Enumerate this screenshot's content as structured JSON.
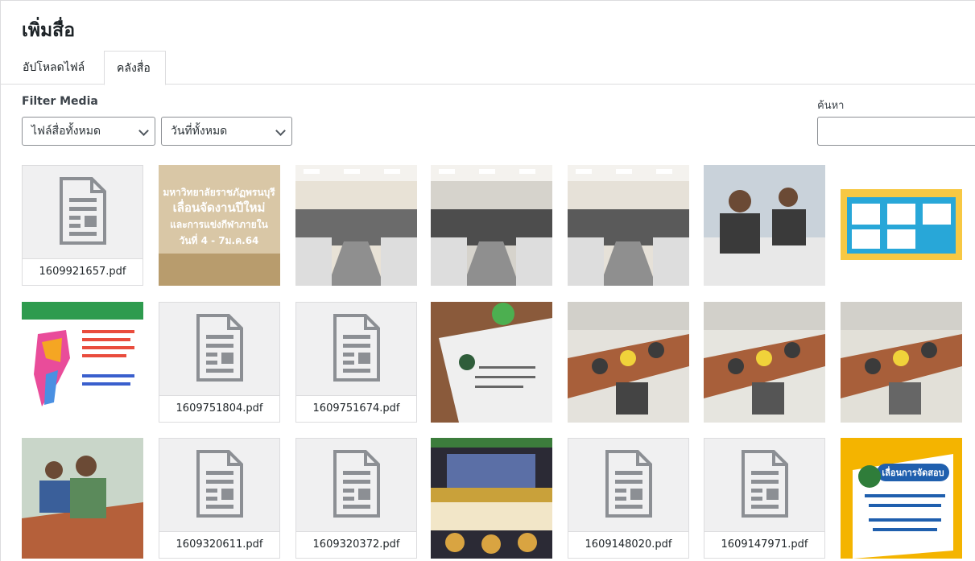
{
  "modal": {
    "title": "เพิ่มสื่อ"
  },
  "tabs": {
    "upload": "อัปโหลดไฟล์",
    "library": "คลังสื่อ"
  },
  "filters": {
    "label": "Filter Media",
    "type_selected": "ไฟล์สื่อทั้งหมด",
    "date_selected": "วันที่ทั้งหมด"
  },
  "search": {
    "label": "ค้นหา",
    "value": ""
  },
  "media": [
    {
      "kind": "document",
      "filename": "1609921657.pdf"
    },
    {
      "kind": "image",
      "caption_lines": [
        "มหาวิทยาลัยราชภัฏพรนบุรี",
        "เลื่อนจัดงานปีใหม่",
        "และการแข่งกีฬาภายใน",
        "วันที่ 4 - 7ม.ค.64"
      ]
    },
    {
      "kind": "image"
    },
    {
      "kind": "image"
    },
    {
      "kind": "image"
    },
    {
      "kind": "image"
    },
    {
      "kind": "image"
    },
    {
      "kind": "image"
    },
    {
      "kind": "document",
      "filename": "1609751804.pdf"
    },
    {
      "kind": "document",
      "filename": "1609751674.pdf"
    },
    {
      "kind": "image"
    },
    {
      "kind": "image"
    },
    {
      "kind": "image"
    },
    {
      "kind": "image"
    },
    {
      "kind": "image"
    },
    {
      "kind": "document",
      "filename": "1609320611.pdf"
    },
    {
      "kind": "document",
      "filename": "1609320372.pdf"
    },
    {
      "kind": "image"
    },
    {
      "kind": "document",
      "filename": "1609148020.pdf"
    },
    {
      "kind": "document",
      "filename": "1609147971.pdf"
    },
    {
      "kind": "image",
      "caption_lines": [
        "เลื่อนการจัดสอบ"
      ]
    }
  ],
  "colors": {
    "accent": "#2271b1",
    "border": "#dcdcde",
    "doc_bg": "#f0f0f1",
    "doc_icon": "#8c8f94"
  }
}
